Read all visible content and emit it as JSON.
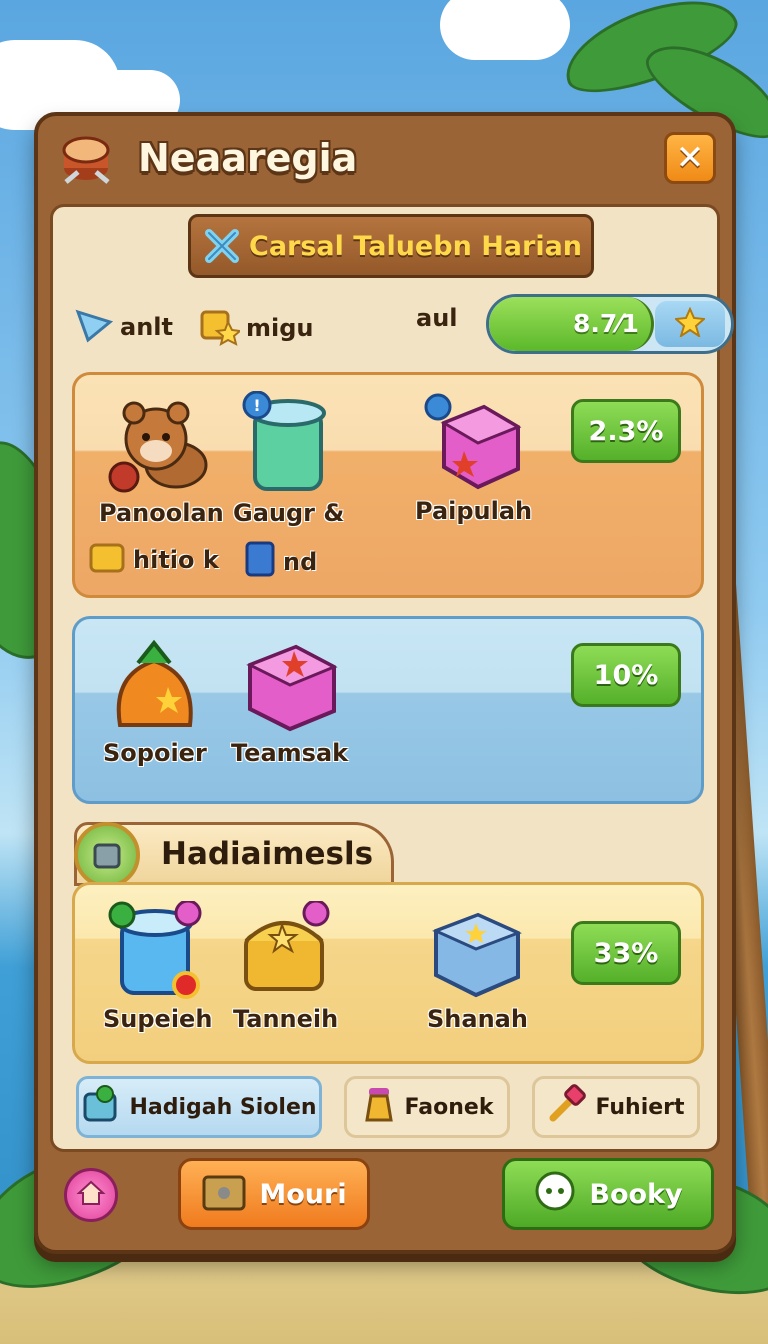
{
  "window": {
    "title": "Neaaregia",
    "close_label": "✕"
  },
  "subtitle": {
    "label": "Carsal Taluebn Harian"
  },
  "resources": {
    "items": [
      {
        "label": "anlt",
        "icon": "blue-gem-icon"
      },
      {
        "label": "migu",
        "icon": "gold-cube-icon"
      }
    ],
    "progress_label": "aul",
    "progress_value": "8.7⁄1",
    "progress_fraction": 0.68,
    "progress_icon": "star-icon"
  },
  "rewards": {
    "orange": {
      "items": [
        {
          "label": "Panoolan",
          "icon": "bear-pet-icon"
        },
        {
          "label": "Gaugr &",
          "icon": "green-jar-icon"
        },
        {
          "label": "Paipulah",
          "icon": "pink-box-icon"
        }
      ],
      "extras": [
        {
          "label": "hitio k",
          "icon": "gold-cube-icon"
        },
        {
          "label": "nd",
          "icon": "blue-card-icon"
        }
      ],
      "percent": "2.3%"
    },
    "blue": {
      "items": [
        {
          "label": "Sopoier",
          "icon": "fruit-bag-icon"
        },
        {
          "label": "Teamsak",
          "icon": "pink-box-icon"
        }
      ],
      "percent": "10%"
    },
    "section": {
      "title": "Hadiaimesls",
      "icon": "chest-medal-icon"
    },
    "yellow": {
      "items": [
        {
          "label": "Supeieh",
          "icon": "blue-jar-icon"
        },
        {
          "label": "Tanneih",
          "icon": "gold-chest-icon"
        },
        {
          "label": "Shanah",
          "icon": "blue-box-icon"
        }
      ],
      "percent": "33%"
    }
  },
  "chips": [
    {
      "label": "Hadigah Siolen",
      "icon": "gem-box-icon"
    },
    {
      "label": "Faonek",
      "icon": "potion-icon"
    },
    {
      "label": "Fuhiert",
      "icon": "hammer-icon"
    }
  ],
  "bottom_bar": {
    "home_icon": "home-icon",
    "left_button": "Mouri",
    "right_button": "Booky"
  },
  "colors": {
    "panel_wood": "#9a6436",
    "panel_inner": "#f2e3c4",
    "accent_green": "#55b02a",
    "accent_orange": "#f08a16",
    "title_gold": "#ffd94a"
  }
}
